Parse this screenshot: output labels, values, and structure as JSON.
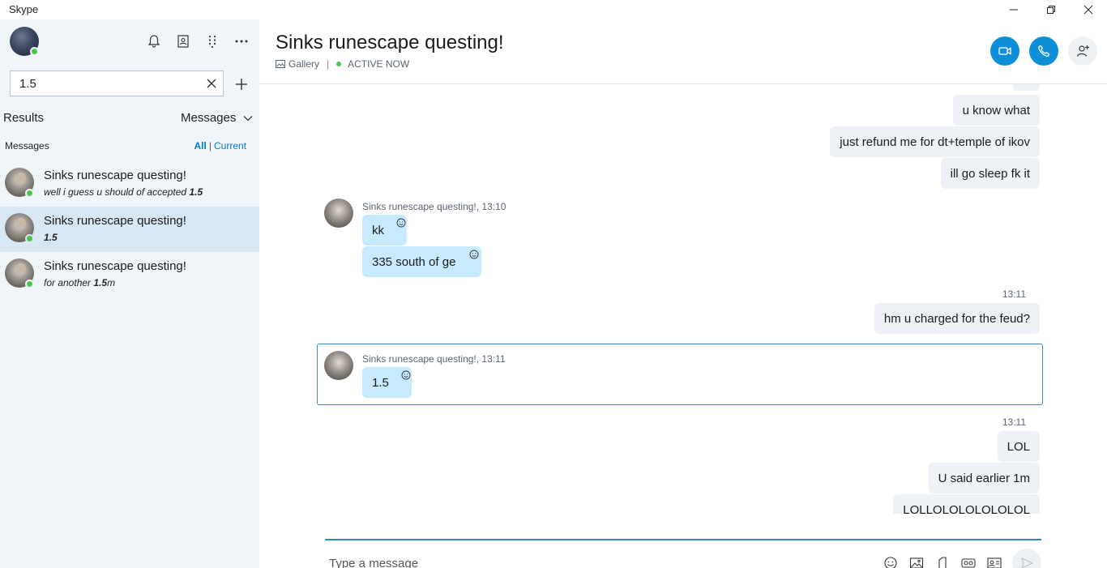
{
  "window": {
    "title": "Skype"
  },
  "colors": {
    "accent": "#0f8fd8",
    "presence": "#4bc54b",
    "selected_row": "#d7e7f4",
    "incoming_bubble": "#c7eaff",
    "outgoing_bubble": "#eef1f5"
  },
  "sidebar": {
    "search_value": "1.5",
    "results_label": "Results",
    "filter_selected": "Messages",
    "messages_label": "Messages",
    "scope_all": "All",
    "scope_sep": "|",
    "scope_current": "Current",
    "results": [
      {
        "title": "Sinks runescape questing!",
        "snippet_pre": "well i guess u should of accepted ",
        "snippet_match": "1.5",
        "snippet_post": "",
        "selected": false
      },
      {
        "title": "Sinks runescape questing!",
        "snippet_pre": "",
        "snippet_match": "1.5",
        "snippet_post": "",
        "selected": true
      },
      {
        "title": "Sinks runescape questing!",
        "snippet_pre": "for another ",
        "snippet_match": "1.5",
        "snippet_post": "m",
        "selected": false
      }
    ]
  },
  "chat": {
    "title": "Sinks runescape questing!",
    "gallery_label": "Gallery",
    "status_sep": "|",
    "status": "ACTIVE NOW",
    "messages": {
      "out1": "u know what",
      "out2": "just refund me for dt+temple of ikov",
      "out3": "ill go sleep fk it",
      "in_meta1": "Sinks runescape questing!,  13:10",
      "in1": "kk",
      "in2": "335 south of ge",
      "ts1": "13:11",
      "out4": "hm u charged for the feud?",
      "in_meta2": "Sinks runescape questing!,  13:11",
      "in3": "1.5",
      "ts2": "13:11",
      "out5": "LOL",
      "out6": "U said earlier 1m",
      "out7": "LOLLOLOLOLOLOLOL"
    },
    "compose_placeholder": "Type a message"
  }
}
